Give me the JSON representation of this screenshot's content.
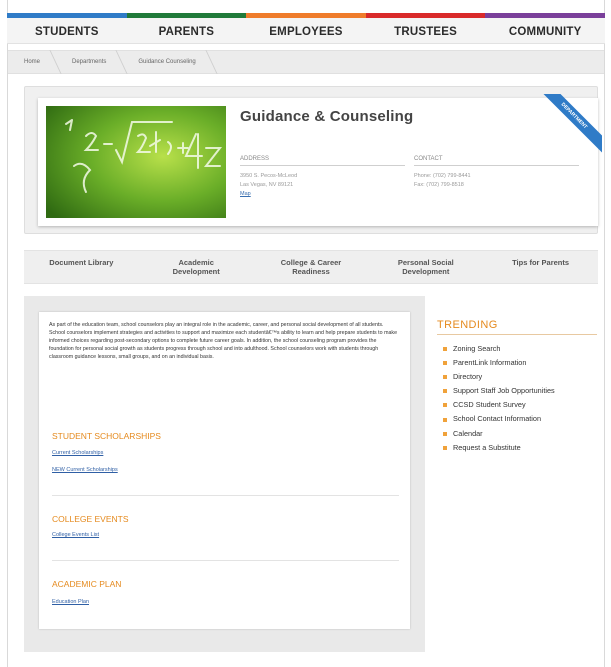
{
  "colors": {
    "bar": [
      "#2f7bc7",
      "#207a3a",
      "#ef7c2b",
      "#d92a2a",
      "#7a3f9a"
    ],
    "accent_orange": "#e58a1e",
    "link_blue": "#2f5fa5"
  },
  "topnav": {
    "items": [
      "STUDENTS",
      "PARENTS",
      "EMPLOYEES",
      "TRUSTEES",
      "COMMUNITY"
    ]
  },
  "breadcrumb": {
    "items": [
      "Home",
      "Departments",
      "Guidance Counseling"
    ]
  },
  "hero": {
    "title": "Guidance & Counseling",
    "ribbon": "DEPARTMENT",
    "address_label": "ADDRESS",
    "address_line1": "3950 S. Pecos-McLeod",
    "address_line2": "Las Vegas, NV 89121",
    "map_link": "Map",
    "contact_label": "CONTACT",
    "phone": "Phone: (702) 799-8441",
    "fax": "Fax: (702) 799-8518",
    "image_icon": "chalkboard-math-image"
  },
  "deptnav": {
    "items": [
      [
        "Document Library",
        ""
      ],
      [
        "Academic",
        "Development"
      ],
      [
        "College & Career",
        "Readiness"
      ],
      [
        "Personal Social",
        "Development"
      ],
      [
        "Tips for Parents",
        ""
      ]
    ]
  },
  "main": {
    "intro": "As part of the education team, school counselors play an integral role in the academic, career, and personal social development of all students. School counselors implement strategies and activities to support and maximize each studentâ€™s ability to learn and help prepare students to make informed choices regarding post-secondary options to complete future career goals. In addition, the school counseling program provides the foundation for personal social growth as students progress through school and into adulthood. School counselors work with students through classroom guidance lessons, small groups, and on an individual basis.",
    "sections": [
      {
        "title": "STUDENT SCHOLARSHIPS",
        "links": [
          "Current Scholarships",
          "NEW Current Scholarships"
        ]
      },
      {
        "title": "COLLEGE EVENTS",
        "links": [
          "College Events List"
        ]
      },
      {
        "title": "ACADEMIC PLAN",
        "links": [
          "Education Plan"
        ]
      }
    ]
  },
  "trending": {
    "title": "TRENDING",
    "items": [
      "Zoning Search",
      "ParentLink Information",
      "Directory",
      "Support Staff Job Opportunities",
      "CCSD Student Survey",
      "School Contact Information",
      "Calendar",
      "Request a Substitute"
    ]
  }
}
